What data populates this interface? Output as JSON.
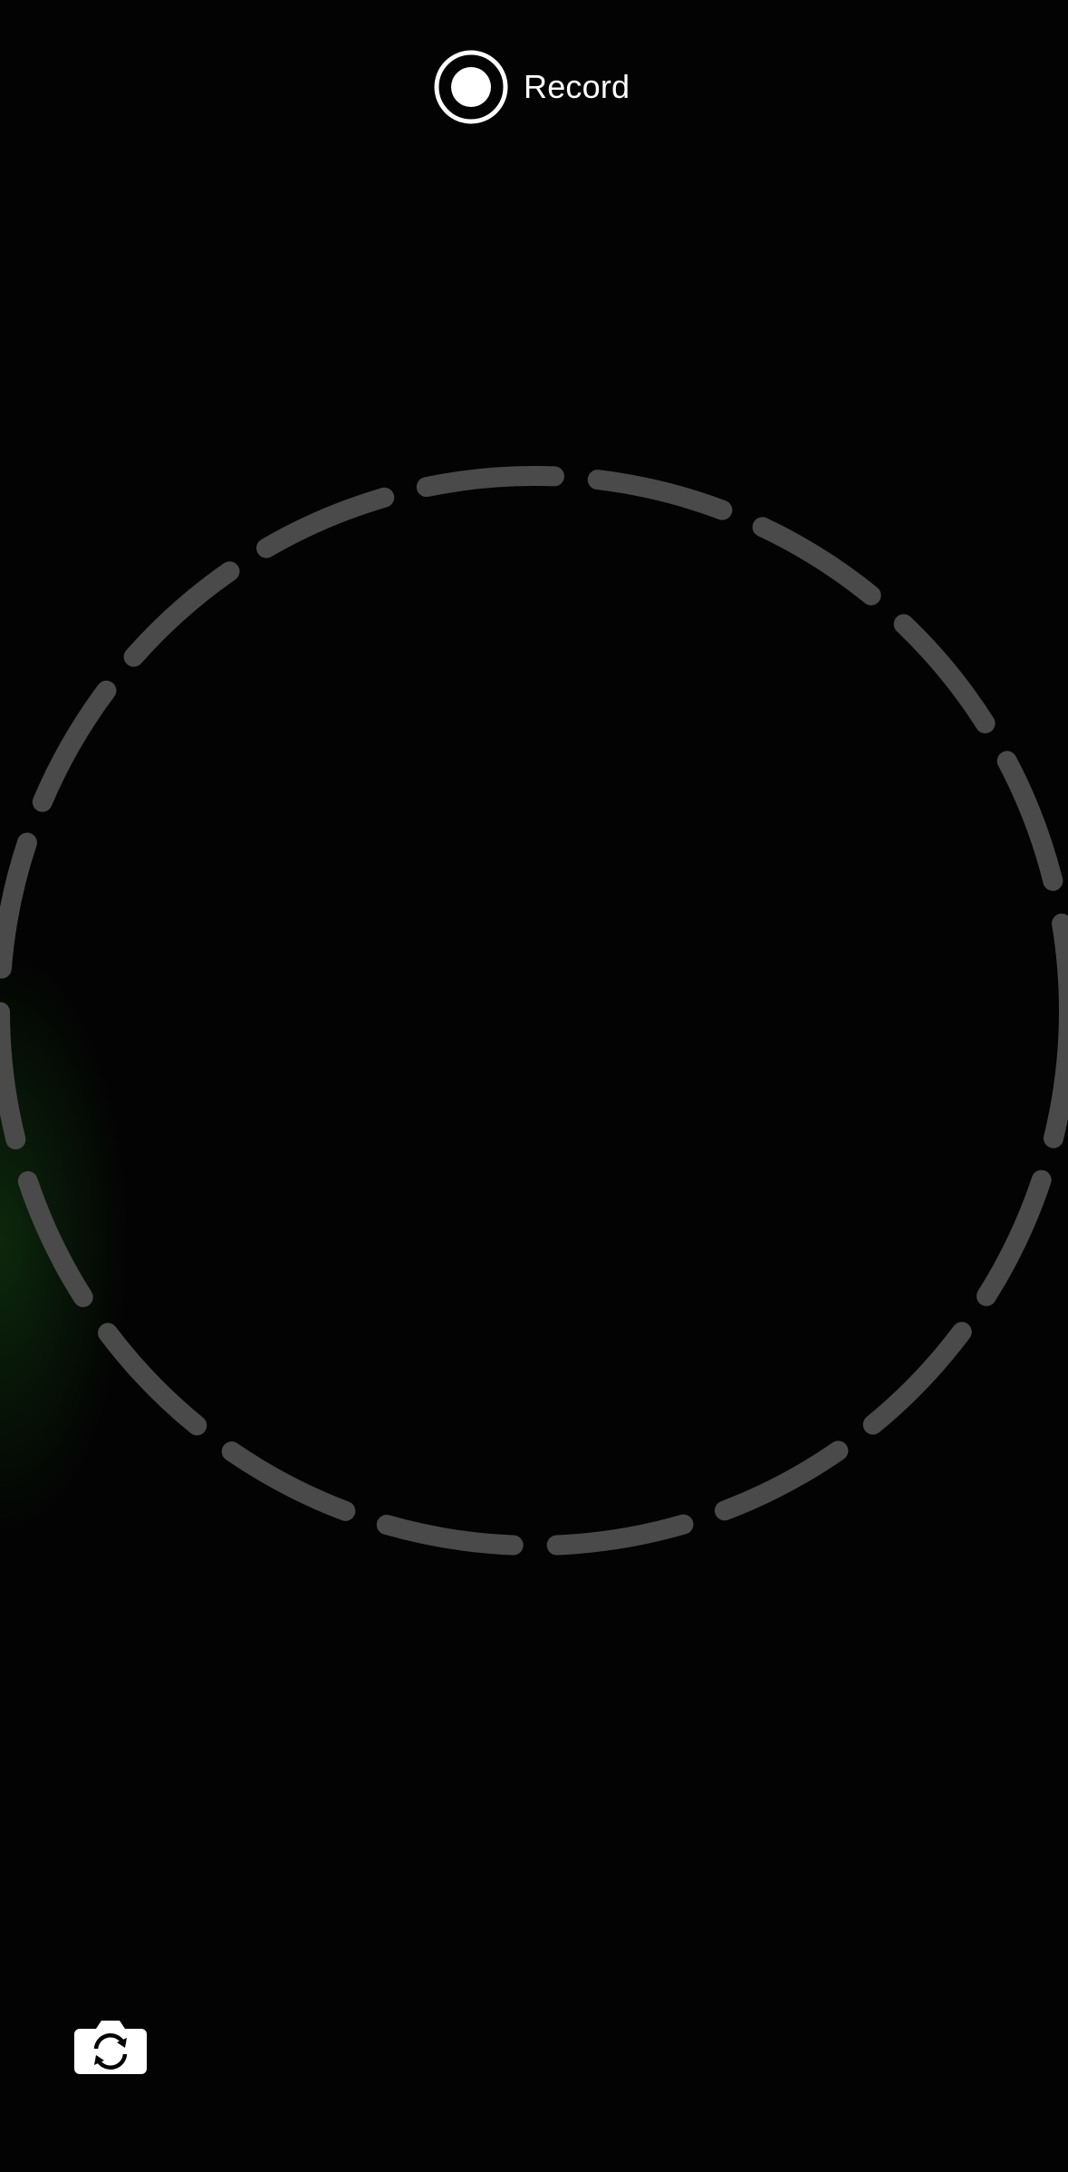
{
  "header": {
    "record_label": "Record",
    "record_icon": "record-icon"
  },
  "viewfinder": {
    "guide_shape": "dashed-circle",
    "guide_color": "#4a4a4a",
    "accent_glow_color": "#144614"
  },
  "controls": {
    "switch_camera_icon": "switch-camera-icon"
  },
  "colors": {
    "background": "#030303",
    "foreground": "#ffffff"
  }
}
